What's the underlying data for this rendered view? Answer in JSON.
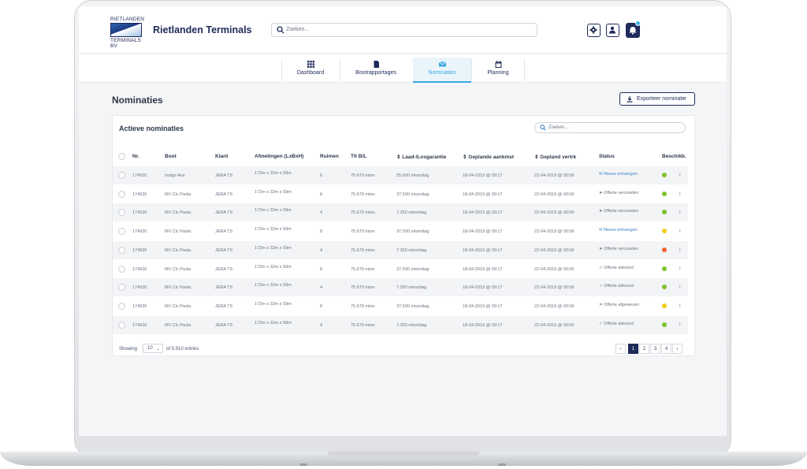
{
  "app": {
    "logo_text_top": "RIETLANDEN",
    "logo_text_bottom": "TERMINALS BV",
    "brand": "Rietlanden Terminals",
    "search_placeholder": "Zoeken..."
  },
  "nav": {
    "tabs": [
      {
        "label": "Dashboard",
        "icon": "grid-icon"
      },
      {
        "label": "Bootrapportages",
        "icon": "document-icon"
      },
      {
        "label": "Nominaties",
        "icon": "envelope-icon",
        "active": true
      },
      {
        "label": "Planning",
        "icon": "calendar-icon"
      }
    ]
  },
  "page": {
    "title": "Nominaties",
    "export_label": "Exporteer nominatie"
  },
  "card": {
    "title": "Actieve nominaties",
    "search_placeholder": "Zoeken..."
  },
  "table": {
    "headers": [
      "Nr.",
      "Boot",
      "Klant",
      "Afmetingen (LxBxH)",
      "Ruimen",
      "Ttl B/L",
      "Laad-/Losgarantie",
      "Geplande aankmst",
      "Gepland vertrk",
      "Status",
      "Beschikb."
    ],
    "rows": [
      {
        "nr": "174920",
        "boot": "Indigo Ace",
        "klant": "JERA TS",
        "afm": "172m x 32m x 59m",
        "ruimen": "6",
        "ttl": "75.670 mton",
        "garantie": "25.000 mton/dag",
        "aankomst": "18-04-2019 @ 09:17",
        "vertrek": "22-04-2019 @ 00:56",
        "status": "Nieuw ontvangen",
        "status_icon": "envelope-icon",
        "beschikbaar": "#7cc22a"
      },
      {
        "nr": "174920",
        "boot": "MV Clc Paola",
        "klant": "JERA TS",
        "afm": "172m x 32m x 59m",
        "ruimen": "8",
        "ttl": "75.670 mton",
        "garantie": "37.500 mton/dag",
        "aankomst": "18-04-2019 @ 09:17",
        "vertrek": "22-04-2019 @ 00:56",
        "status": "Offerte verzonden",
        "status_icon": "send-icon",
        "beschikbaar": "#7cc22a"
      },
      {
        "nr": "174920",
        "boot": "MV Clc Paola",
        "klant": "JERA TS",
        "afm": "172m x 32m x 59m",
        "ruimen": "4",
        "ttl": "75.670 mton",
        "garantie": "7.250 mton/dag",
        "aankomst": "18-04-2019 @ 09:17",
        "vertrek": "22-04-2019 @ 00:56",
        "status": "Offerte verzonden",
        "status_icon": "send-icon",
        "beschikbaar": "#7cc22a"
      },
      {
        "nr": "174920",
        "boot": "MV Clc Paola",
        "klant": "JERA TS",
        "afm": "172m x 32m x 59m",
        "ruimen": "8",
        "ttl": "75.670 mton",
        "garantie": "37.500 mton/dag",
        "aankomst": "18-04-2019 @ 09:17",
        "vertrek": "22-04-2019 @ 00:56",
        "status": "Nieuw ontvangen",
        "status_icon": "envelope-icon",
        "beschikbaar": "#f2cc19"
      },
      {
        "nr": "174920",
        "boot": "MV Clc Paola",
        "klant": "JERA TS",
        "afm": "172m x 32m x 59m",
        "ruimen": "4",
        "ttl": "75.670 mton",
        "garantie": "7.250 mton/dag",
        "aankomst": "18-04-2019 @ 09:17",
        "vertrek": "22-04-2019 @ 00:56",
        "status": "Offerte verzonden",
        "status_icon": "send-icon",
        "beschikbaar": "#f0642a"
      },
      {
        "nr": "174920",
        "boot": "MV Clc Paola",
        "klant": "JERA TS",
        "afm": "172m x 32m x 59m",
        "ruimen": "8",
        "ttl": "75.670 mton",
        "garantie": "37.500 mton/dag",
        "aankomst": "18-04-2019 @ 09:17",
        "vertrek": "22-04-2019 @ 00:56",
        "status": "Offerte akkoord",
        "status_icon": "check-icon",
        "beschikbaar": "#7cc22a"
      },
      {
        "nr": "174920",
        "boot": "MV Clc Paola",
        "klant": "JERA TS",
        "afm": "172m x 32m x 59m",
        "ruimen": "4",
        "ttl": "75.670 mton",
        "garantie": "7.250 mton/dag",
        "aankomst": "18-04-2019 @ 09:17",
        "vertrek": "22-04-2019 @ 00:56",
        "status": "Offerte akkoord",
        "status_icon": "check-icon",
        "beschikbaar": "#7cc22a"
      },
      {
        "nr": "174920",
        "boot": "MV Clc Paola",
        "klant": "JERA TS",
        "afm": "172m x 32m x 59m",
        "ruimen": "8",
        "ttl": "75.670 mton",
        "garantie": "37.500 mton/dag",
        "aankomst": "18-04-2019 @ 09:17",
        "vertrek": "22-04-2019 @ 00:56",
        "status": "Offerte afgewezen",
        "status_icon": "cross-icon",
        "beschikbaar": "#f2cc19"
      },
      {
        "nr": "174920",
        "boot": "MV Clc Paola",
        "klant": "JERA TS",
        "afm": "172m x 32m x 59m",
        "ruimen": "4",
        "ttl": "75.670 mton",
        "garantie": "7.250 mton/dag",
        "aankomst": "18-04-2019 @ 09:17",
        "vertrek": "22-04-2019 @ 00:56",
        "status": "Offerte akkoord",
        "status_icon": "check-icon",
        "beschikbaar": "#7cc22a"
      }
    ]
  },
  "footer": {
    "showing_label": "Showing",
    "per_page": "10",
    "entries_label": "of 5.910 entries",
    "pages": [
      "1",
      "2",
      "3",
      "4"
    ],
    "current_page": "1"
  }
}
